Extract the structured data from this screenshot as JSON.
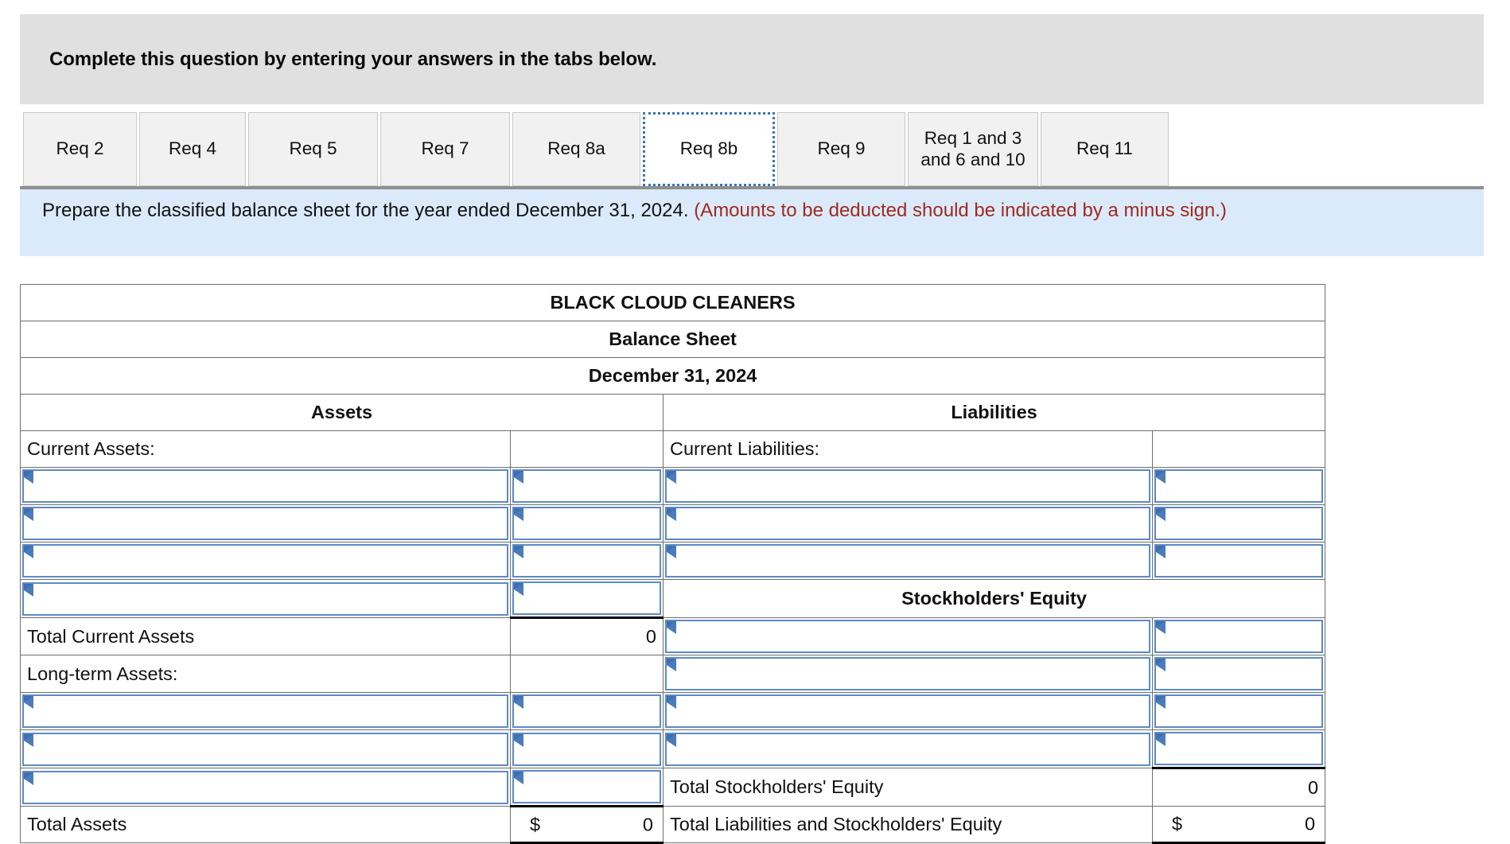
{
  "banner": {
    "text": "Complete this question by entering your answers in the tabs below."
  },
  "tabs": [
    {
      "label": "Req 2",
      "active": false
    },
    {
      "label": "Req 4",
      "active": false
    },
    {
      "label": "Req 5",
      "active": false
    },
    {
      "label": "Req 7",
      "active": false
    },
    {
      "label": "Req 8a",
      "active": false
    },
    {
      "label": "Req 8b",
      "active": true
    },
    {
      "label": "Req 9",
      "active": false
    },
    {
      "label": "Req 1 and 3 and 6 and 10",
      "active": false
    },
    {
      "label": "Req 11",
      "active": false
    }
  ],
  "requirement": {
    "main": "Prepare the classified balance sheet for the year ended December 31, 2024.",
    "note": "(Amounts to be deducted should be indicated by a minus sign.)"
  },
  "sheet": {
    "company": "BLACK CLOUD CLEANERS",
    "statement": "Balance Sheet",
    "date": "December 31, 2024",
    "left_header": "Assets",
    "right_header": "Liabilities",
    "equity_header": "Stockholders' Equity",
    "labels": {
      "current_assets": "Current Assets:",
      "total_current_assets": "Total Current Assets",
      "long_term_assets": "Long-term Assets:",
      "total_assets": "Total Assets",
      "current_liabilities": "Current Liabilities:",
      "total_stockholders_equity": "Total Stockholders' Equity",
      "total_liab_and_equity": "Total Liabilities and Stockholders' Equity"
    },
    "values": {
      "total_current_assets": "0",
      "total_assets_symbol": "$",
      "total_assets": "0",
      "total_stockholders_equity": "0",
      "total_liab_and_equity_symbol": "$",
      "total_liab_and_equity": "0"
    }
  },
  "colors": {
    "header_blue": "#85abdf",
    "banner_gray": "#e0e0e0",
    "requirement_blue": "#dbeafb",
    "warning_red": "#9e2a1e",
    "entry_border": "#5d8bc4",
    "active_tab_border": "#3b72b9"
  }
}
